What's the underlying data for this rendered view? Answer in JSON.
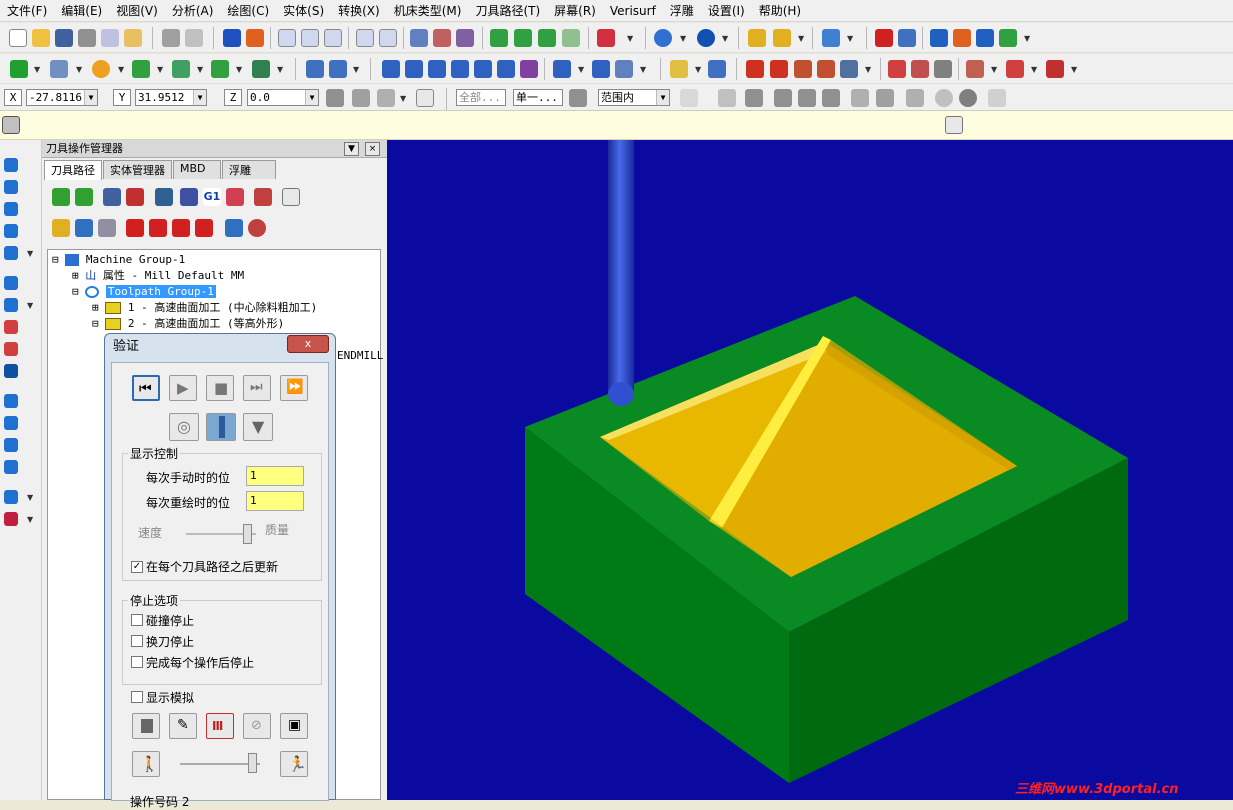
{
  "menu": [
    "文件(F)",
    "编辑(E)",
    "视图(V)",
    "分析(A)",
    "绘图(C)",
    "实体(S)",
    "转换(X)",
    "机床类型(M)",
    "刀具路径(T)",
    "屏幕(R)",
    "Verisurf",
    "浮雕",
    "设置(I)",
    "帮助(H)"
  ],
  "coords": {
    "x_label": "X",
    "x_value": "-27.8116(",
    "y_label": "Y",
    "y_value": "31.9512",
    "z_label": "Z",
    "z_value": "0.0"
  },
  "selection": {
    "all": "全部...",
    "single": "单一...",
    "range": "范围内"
  },
  "panel": {
    "title": "刀具操作管理器",
    "tabs": [
      "刀具路径",
      "实体管理器",
      "MBD",
      "浮雕"
    ],
    "tree": {
      "machine_group": "Machine Group-1",
      "properties": "属性 - Mill Default MM",
      "toolpath_group": "Toolpath Group-1",
      "op1": "1 - 高速曲面加工 (中心除料粗加工)",
      "op2": "2 - 高速曲面加工 (等高外形)",
      "endmill_fragment": "ENDMILL"
    }
  },
  "dialog": {
    "title": "验证",
    "close": "x",
    "display_control": "显示控制",
    "manual_step_label": "每次手动时的位",
    "manual_step_value": "1",
    "redraw_step_label": "每次重绘时的位",
    "redraw_step_value": "1",
    "speed": "速度",
    "quality": "质量",
    "update_after_each": "在每个刀具路径之后更新",
    "update_after_each_checked": true,
    "stop_options": "停止选项",
    "stop_collision": "碰撞停止",
    "stop_toolchange": "换刀停止",
    "stop_each_op": "完成每个操作后停止",
    "show_sim": "显示模拟",
    "op_number": "操作号码  2"
  },
  "watermark": "三维网www.3dportal.cn"
}
